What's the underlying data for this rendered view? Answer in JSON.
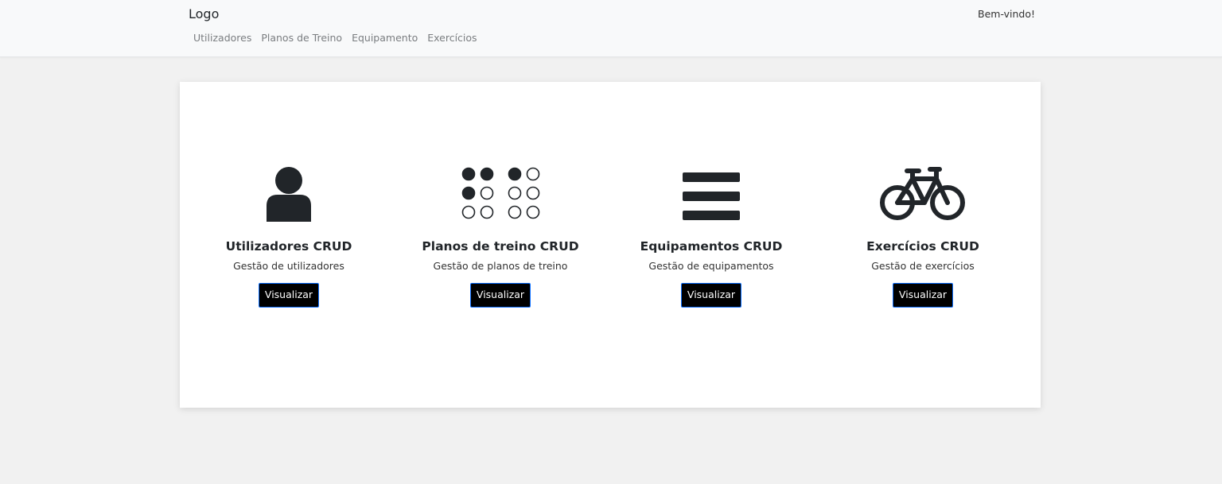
{
  "navbar": {
    "brand": "Logo",
    "links": [
      "Utilizadores",
      "Planos de Treino",
      "Equipamento",
      "Exercícios"
    ],
    "welcome": "Bem-vindo!"
  },
  "features": [
    {
      "icon": "user-icon",
      "title": "Utilizadores CRUD",
      "description": "Gestão de utilizadores",
      "button": "Visualizar"
    },
    {
      "icon": "braille-dots-icon",
      "title": "Planos de treino CRUD",
      "description": "Gestão de planos de treino",
      "button": "Visualizar"
    },
    {
      "icon": "menu-bars-icon",
      "title": "Equipamentos CRUD",
      "description": "Gestão de equipamentos",
      "button": "Visualizar"
    },
    {
      "icon": "bicycle-icon",
      "title": "Exercícios CRUD",
      "description": "Gestão de exercícios",
      "button": "Visualizar"
    }
  ],
  "colors": {
    "navbar_bg": "#f8f9fa",
    "page_bg": "#f1f1f1",
    "icon": "#212529",
    "button_bg": "#000000",
    "button_border": "#0d6efd"
  }
}
